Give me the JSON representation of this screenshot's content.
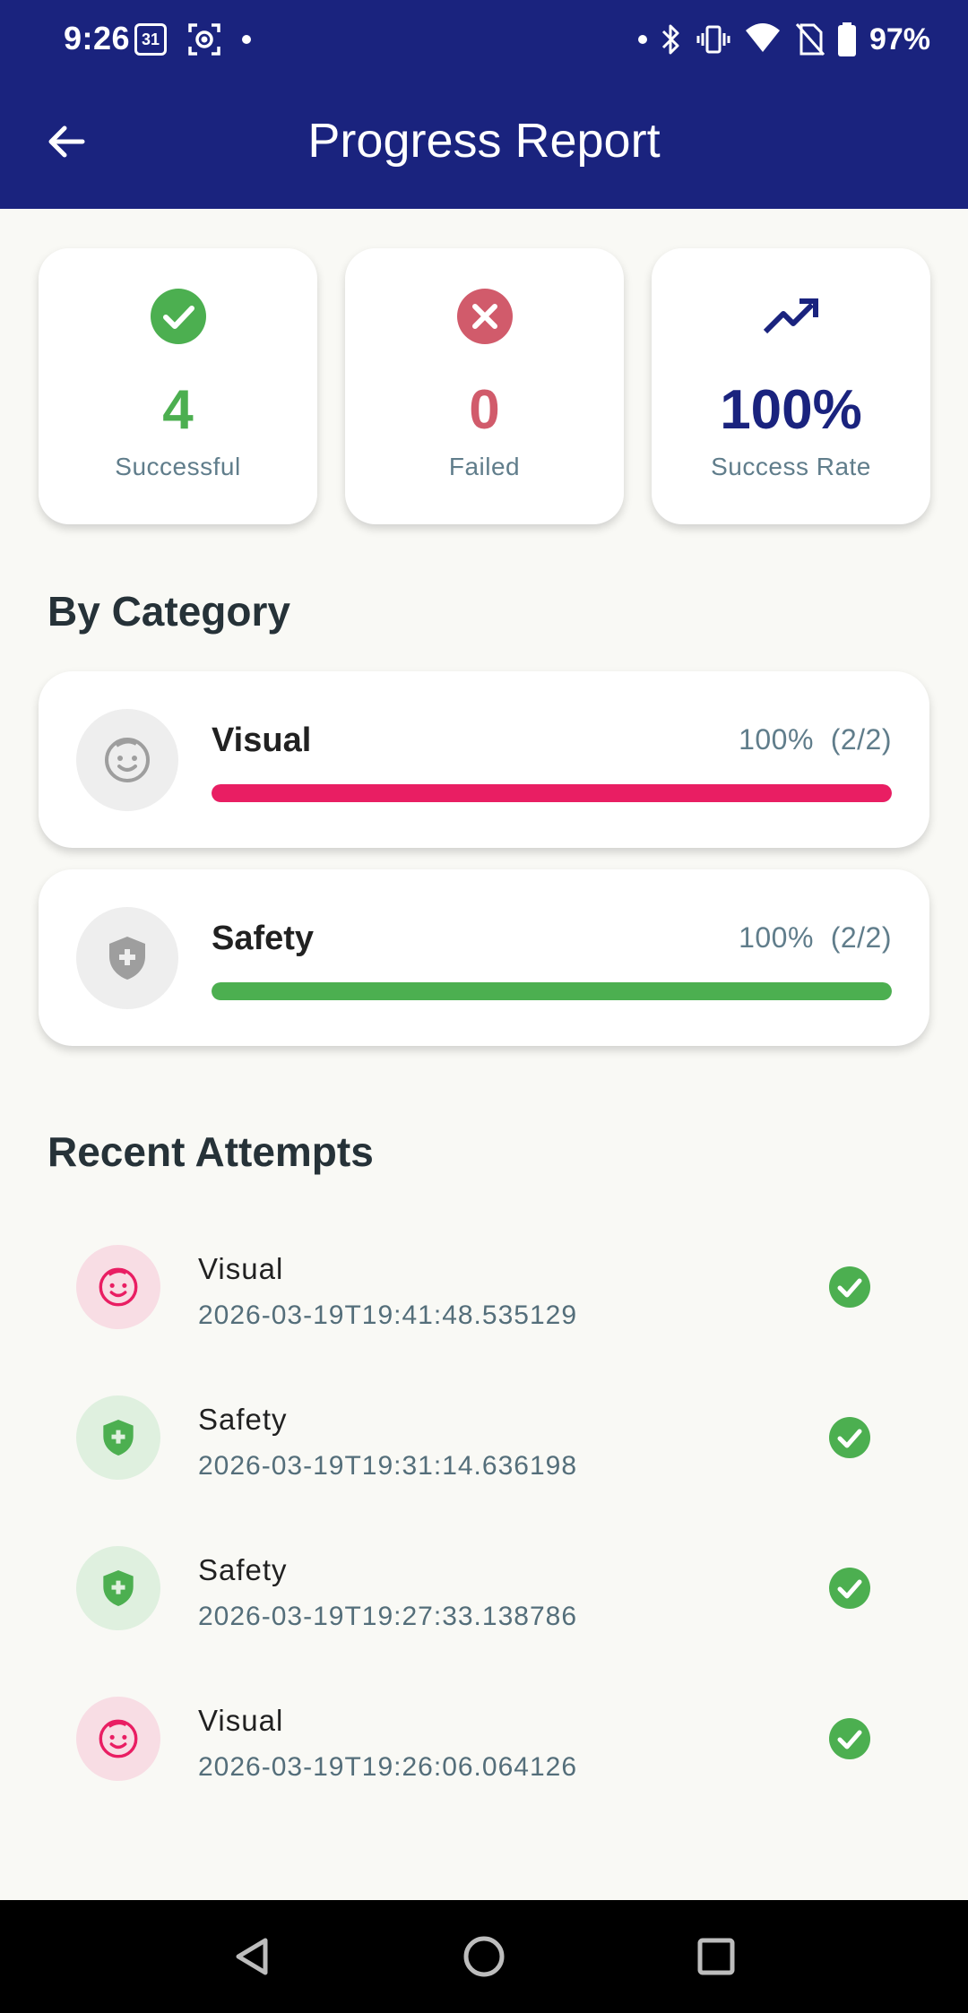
{
  "status_bar": {
    "time": "9:26",
    "calendar_day": "31",
    "battery": "97%"
  },
  "app_bar": {
    "title": "Progress Report",
    "back_icon": "arrow-left-icon"
  },
  "stats": [
    {
      "value": "4",
      "label": "Successful",
      "icon": "check-circle-icon",
      "color": "#4caf50"
    },
    {
      "value": "0",
      "label": "Failed",
      "icon": "cancel-circle-icon",
      "color": "#d15b6b"
    },
    {
      "value": "100%",
      "label": "Success Rate",
      "icon": "trending-up-icon",
      "color": "#1a237e"
    }
  ],
  "by_category": {
    "title": "By Category",
    "items": [
      {
        "name": "Visual",
        "percent": "100%",
        "count": "(2/2)",
        "progress": 1.0,
        "bar_color": "#e91e63",
        "icon": "baby-face-icon"
      },
      {
        "name": "Safety",
        "percent": "100%",
        "count": "(2/2)",
        "progress": 1.0,
        "bar_color": "#4caf50",
        "icon": "shield-plus-icon"
      }
    ]
  },
  "recent_attempts": {
    "title": "Recent Attempts",
    "items": [
      {
        "category": "Visual",
        "timestamp": "2026-03-19T19:41:48.535129",
        "icon": "baby-face-icon",
        "status": "success"
      },
      {
        "category": "Safety",
        "timestamp": "2026-03-19T19:31:14.636198",
        "icon": "shield-plus-icon",
        "status": "success"
      },
      {
        "category": "Safety",
        "timestamp": "2026-03-19T19:27:33.138786",
        "icon": "shield-plus-icon",
        "status": "success"
      },
      {
        "category": "Visual",
        "timestamp": "2026-03-19T19:26:06.064126",
        "icon": "baby-face-icon",
        "status": "success"
      }
    ]
  },
  "colors": {
    "primary": "#1a237e",
    "success": "#4caf50",
    "failed": "#d15b6b",
    "visual": "#e91e63",
    "background": "#f9f9f5"
  }
}
